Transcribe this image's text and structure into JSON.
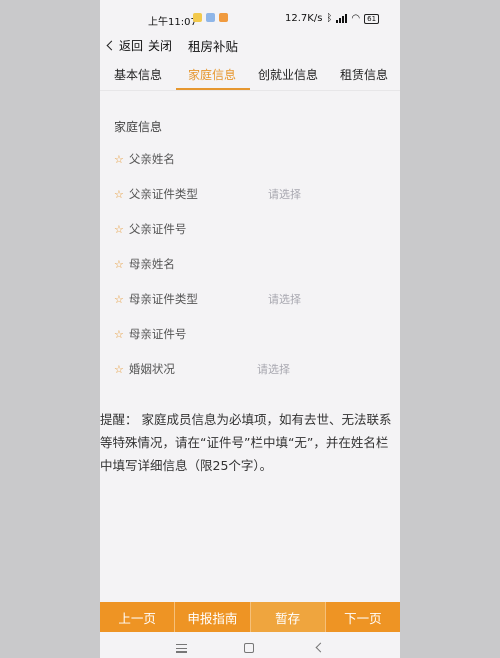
{
  "status_bar": {
    "time": "上午11:07",
    "network_speed": "12.7K/s",
    "battery": "61",
    "app_icon_colors": [
      "#f2c94c",
      "#8fb6e8",
      "#f09a3e"
    ]
  },
  "nav": {
    "back_label": "返回",
    "close_label": "关闭",
    "title": "租房补贴"
  },
  "tabs": [
    {
      "label": "基本信息",
      "active": false
    },
    {
      "label": "家庭信息",
      "active": true
    },
    {
      "label": "创就业信息",
      "active": false
    },
    {
      "label": "租赁信息",
      "active": false
    }
  ],
  "section_title": "家庭信息",
  "fields": [
    {
      "label": "父亲姓名",
      "placeholder": ""
    },
    {
      "label": "父亲证件类型",
      "placeholder": "请选择"
    },
    {
      "label": "父亲证件号",
      "placeholder": ""
    },
    {
      "label": "母亲姓名",
      "placeholder": ""
    },
    {
      "label": "母亲证件类型",
      "placeholder": "请选择"
    },
    {
      "label": "母亲证件号",
      "placeholder": ""
    },
    {
      "label": "婚姻状况",
      "placeholder": "请选择"
    }
  ],
  "required_mark": "☆",
  "note": "提醒：  家庭成员信息为必填项，如有去世、无法联系等特殊情况，请在“证件号”栏中填“无”，并在姓名栏中填写详细信息（限25个字）。",
  "actions": {
    "prev": "上一页",
    "guide": "申报指南",
    "save": "暂存",
    "next": "下一页"
  },
  "colors": {
    "accent": "#e6972f",
    "button": "#ee9424"
  }
}
